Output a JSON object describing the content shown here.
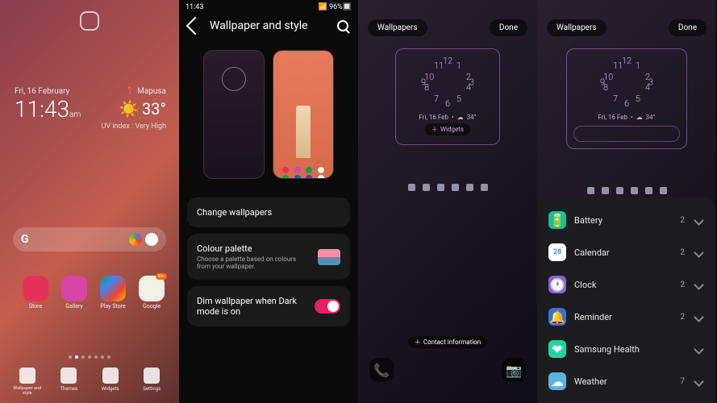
{
  "panel1": {
    "date": "Fri, 16 February",
    "time": "11:43",
    "ampm": "am",
    "location": "Mapusa",
    "temperature": "33°",
    "uv": "UV index : Very High",
    "search_label": "G",
    "apps": [
      {
        "name": "Store",
        "color": "#e6325a"
      },
      {
        "name": "Gallery",
        "color": "#d945a5"
      },
      {
        "name": "Play Store",
        "color": "#1abc60"
      },
      {
        "name": "Google",
        "color": "#f5f0e5",
        "badge": "99+"
      }
    ],
    "nav": [
      {
        "label": "Wallpaper and style"
      },
      {
        "label": "Themes"
      },
      {
        "label": "Widgets"
      },
      {
        "label": "Settings"
      }
    ]
  },
  "panel2": {
    "status_time": "11:43",
    "status_battery": "96%",
    "title": "Wallpaper and style",
    "option1": "Change wallpapers",
    "option2_title": "Colour palette",
    "option2_sub": "Choose a palette based on colours from your wallpaper.",
    "option3": "Dim wallpaper when Dark mode is on",
    "dim_enabled": true
  },
  "panel3": {
    "back_label": "Wallpapers",
    "done_label": "Done",
    "lock_date": "Fri, 16 Feb",
    "lock_temp": "34°",
    "widgets_btn": "Widgets",
    "contact_btn": "Contact information"
  },
  "panel4": {
    "back_label": "Wallpapers",
    "done_label": "Done",
    "lock_date": "Fri, 16 Feb",
    "lock_temp": "34°",
    "widgets": [
      {
        "name": "Battery",
        "count": "2",
        "color": "#1abc9c"
      },
      {
        "name": "Calendar",
        "count": "2",
        "color": "#3498db",
        "day": "28"
      },
      {
        "name": "Clock",
        "count": "2",
        "color": "#8e5fd0"
      },
      {
        "name": "Reminder",
        "count": "2",
        "color": "#3a6fd8"
      },
      {
        "name": "Samsung Health",
        "count": "",
        "color": "#1dd6a3"
      },
      {
        "name": "Weather",
        "count": "7",
        "color": "#5ab4e0"
      }
    ]
  }
}
